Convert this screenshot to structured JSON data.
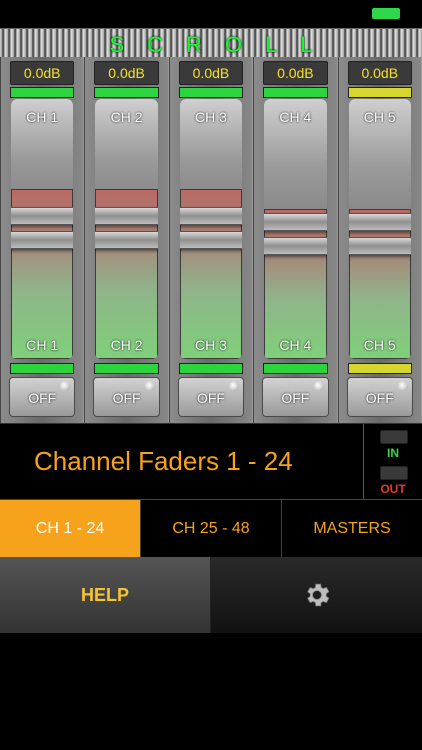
{
  "status": {
    "battery_color": "#2fd84a"
  },
  "scroll": {
    "label": "SCROLL"
  },
  "channels": [
    {
      "db": "0.0dB",
      "name_top": "CH 1",
      "name_bottom": "CH 1",
      "meter": "green",
      "off": "OFF"
    },
    {
      "db": "0.0dB",
      "name_top": "CH 2",
      "name_bottom": "CH 2",
      "meter": "green",
      "off": "OFF"
    },
    {
      "db": "0.0dB",
      "name_top": "CH 3",
      "name_bottom": "CH 3",
      "meter": "green",
      "off": "OFF"
    },
    {
      "db": "0.0dB",
      "name_top": "CH 4",
      "name_bottom": "CH 4",
      "meter": "green",
      "off": "OFF"
    },
    {
      "db": "0.0dB",
      "name_top": "CH 5",
      "name_bottom": "CH 5",
      "meter": "yellow",
      "off": "OFF"
    }
  ],
  "header": {
    "title": "Channel Faders 1 - 24",
    "in_label": "IN",
    "out_label": "OUT",
    "in_color": "#2fd84a",
    "out_color": "#e03a2a"
  },
  "tabs": [
    {
      "label": "CH 1 - 24",
      "active": true
    },
    {
      "label": "CH 25 - 48",
      "active": false
    },
    {
      "label": "MASTERS",
      "active": false
    }
  ],
  "footer": {
    "help_label": "HELP",
    "settings_icon": "gear-icon"
  },
  "colors": {
    "accent": "#f7a21b",
    "scroll_text": "#0cff2a",
    "db_text": "#f7e027"
  }
}
